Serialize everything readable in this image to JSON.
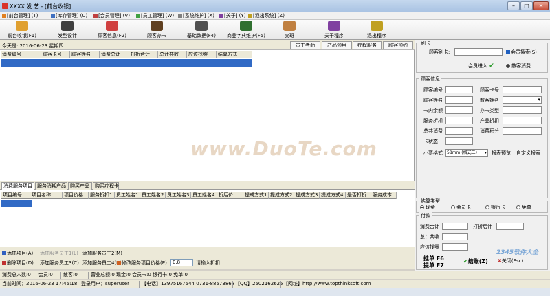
{
  "window": {
    "title": "XXXX 发 艺 - [前台收银]",
    "minimize": "–",
    "maximize": "□",
    "close": "✕"
  },
  "menu": [
    "[前台管理] (T)",
    "[库存管理] (U)",
    "[会员管理] (V)",
    "[员工管理] (W)",
    "[系统维护] (X)",
    "[关于] (Y)",
    "[退出系统] (Z)"
  ],
  "toolbar": [
    {
      "label": "前台收银(F1)",
      "icon": "cash-register-icon",
      "color": "#e0a030"
    },
    {
      "label": "发型设计",
      "icon": "eye-icon",
      "color": "#404040"
    },
    {
      "label": "顾客信息(F2)",
      "icon": "customer-icon",
      "color": "#d04040"
    },
    {
      "label": "顾客办卡",
      "icon": "card-icon",
      "color": "#604020"
    },
    {
      "label": "基础数据(F4)",
      "icon": "data-icon",
      "color": "#505050"
    },
    {
      "label": "商品字典维护(F5)",
      "icon": "dictionary-icon",
      "color": "#307030"
    },
    {
      "label": "交班",
      "icon": "handshake-icon",
      "color": "#c08040"
    },
    {
      "label": "关于程序",
      "icon": "about-icon",
      "color": "#8040a0"
    },
    {
      "label": "退出程序",
      "icon": "exit-icon",
      "color": "#c0a020"
    }
  ],
  "datebar": {
    "today": "今天是:  2016-06-23    星期四"
  },
  "quick_buttons": [
    "员工考勤",
    "产品领用",
    "疗程服务",
    "顾客预约"
  ],
  "consume_table": {
    "columns": [
      "消费编号",
      "顾客卡号",
      "顾客姓名",
      "消费总计",
      "打折合计",
      "总计共收",
      "应该找零",
      "结算方式"
    ]
  },
  "tabs": [
    "消费服务项目",
    "服务消耗产品",
    "购买产品",
    "购买疗程卡"
  ],
  "service_table": {
    "columns": [
      "项目编号",
      "项目名称",
      "项目价格",
      "服务折扣1",
      "员工姓名1",
      "员工姓名2",
      "员工姓名3",
      "员工姓名4",
      "折后价",
      "提成方式1",
      "提成方式2",
      "提成方式3",
      "提成方式4",
      "是否打折",
      "服务成本"
    ]
  },
  "bottom": {
    "add_item": "添加项目(A)",
    "add_staff1": "添加服务员工1(L)",
    "add_staff2": "添加服务员工2(M)",
    "del_item": "删除项目(D)",
    "add_staff3": "添加服务员工3(C)",
    "add_staff4": "添加服务员工4(B)",
    "modify_price": "修改服务项目价格(E)",
    "discount_value": "0.8",
    "discount_hint": "请输入折扣"
  },
  "swipe": {
    "legend": "刷卡",
    "label": "顾客刷卡:",
    "search": "会员搜索(S)",
    "member_in": "会员进入",
    "walk_in": "散客消费"
  },
  "customer": {
    "legend": "顾客信息",
    "fields_left": [
      "顾客编号",
      "顾客姓名",
      "卡内余额",
      "服务折扣",
      "总共消费",
      "卡状态"
    ],
    "fields_right": [
      "顾客卡号",
      "散客姓名",
      "办卡类型",
      "产品折扣",
      "消费积分"
    ],
    "receipt_label": "小票格式",
    "receipt_value": "58mm (格式二)",
    "receipt_preview": "报表预览",
    "custom_report": "自定义报表"
  },
  "settle": {
    "legend": "结算类型",
    "options": [
      "现金",
      "会员卡",
      "银行卡",
      "免单"
    ]
  },
  "payment": {
    "legend": "付款",
    "total": "消费合计",
    "after_discount": "打折后计",
    "total_collect": "总计共收",
    "change": "应该找零",
    "hang": "挂单 F6",
    "get": "提单 F7",
    "checkout": "结账(Z)",
    "close": "关闭(Esc)"
  },
  "status1": [
    "消费总人数:0",
    "会员:0",
    "散客:0",
    "营业总额:0 现金:0 会员卡:0 银行卡:0 免单:0"
  ],
  "status2": [
    "当前时间：2016-06-23 17:45:18",
    "登录用户：superuser",
    "【电话】13975167544  0731-88573868",
    "【QQ】2502162625",
    "【网址】http://www.topthinksoft.com"
  ],
  "watermark": "www.DuoTe.com",
  "corner_watermark": "2345软件大全"
}
